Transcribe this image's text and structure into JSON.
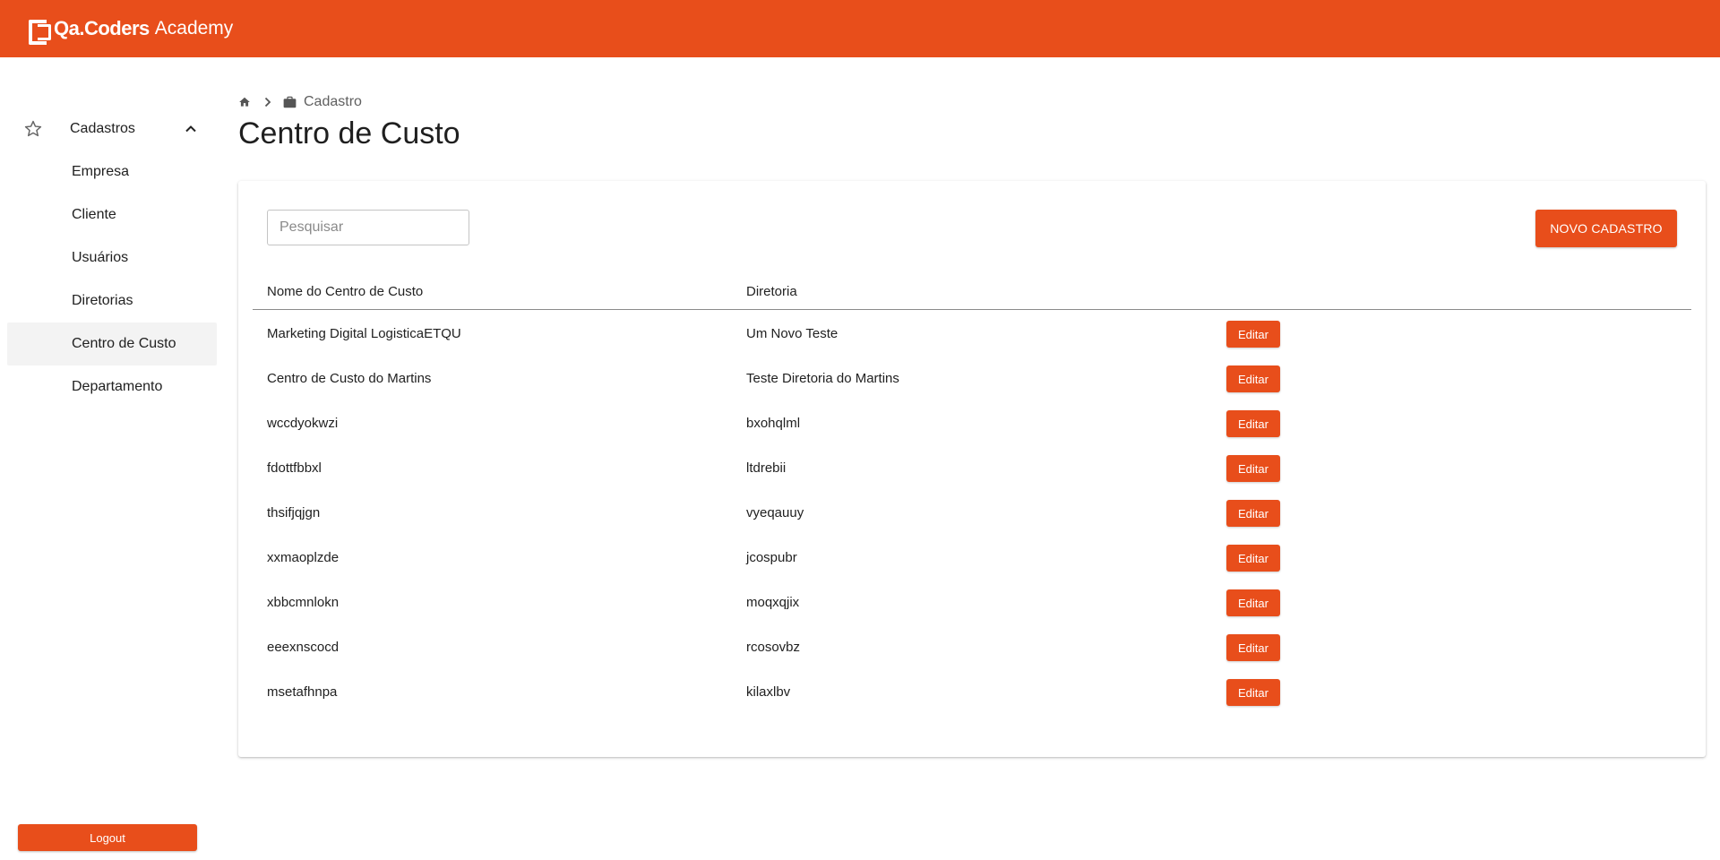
{
  "header": {
    "brand_strong": "Qa.Coders",
    "brand_light": "Academy",
    "accent_color": "#e84e1b"
  },
  "sidebar": {
    "group": {
      "label": "Cadastros",
      "icon": "star-outline-icon",
      "expanded": true
    },
    "items": [
      {
        "label": "Empresa",
        "active": false
      },
      {
        "label": "Cliente",
        "active": false
      },
      {
        "label": "Usuários",
        "active": false
      },
      {
        "label": "Diretorias",
        "active": false
      },
      {
        "label": "Centro de Custo",
        "active": true
      },
      {
        "label": "Departamento",
        "active": false
      }
    ],
    "logout_label": "Logout"
  },
  "breadcrumb": {
    "home_icon": "home-icon",
    "separator_icon": "chevron-right-icon",
    "section_icon": "briefcase-icon",
    "label": "Cadastro"
  },
  "page": {
    "title": "Centro de Custo"
  },
  "toolbar": {
    "search_placeholder": "Pesquisar",
    "new_button_label": "NOVO CADASTRO"
  },
  "table": {
    "columns": [
      "Nome do Centro de Custo",
      "Diretoria"
    ],
    "edit_label": "Editar",
    "rows": [
      {
        "name": "Marketing Digital LogisticaETQU",
        "diretoria": "Um Novo Teste"
      },
      {
        "name": "Centro de Custo do Martins",
        "diretoria": "Teste Diretoria do Martins"
      },
      {
        "name": "wccdyokwzi",
        "diretoria": "bxohqlml"
      },
      {
        "name": "fdottfbbxl",
        "diretoria": "ltdrebii"
      },
      {
        "name": "thsifjqjgn",
        "diretoria": "vyeqauuy"
      },
      {
        "name": "xxmaoplzde",
        "diretoria": "jcospubr"
      },
      {
        "name": "xbbcmnlokn",
        "diretoria": "moqxqjix"
      },
      {
        "name": "eeexnscocd",
        "diretoria": "rcosovbz"
      },
      {
        "name": "msetafhnpa",
        "diretoria": "kilaxlbv"
      }
    ]
  }
}
